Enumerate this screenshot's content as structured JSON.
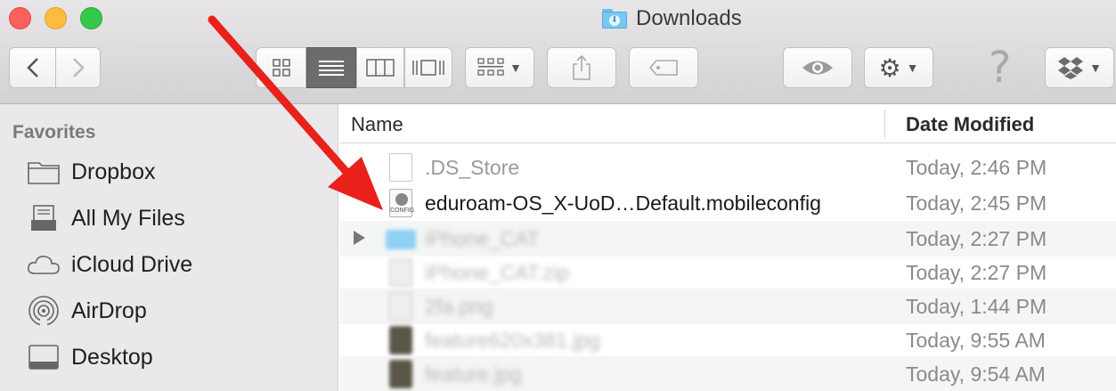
{
  "window": {
    "title": "Downloads"
  },
  "sidebar": {
    "heading": "Favorites",
    "items": [
      {
        "label": "Dropbox",
        "icon": "folder-icon"
      },
      {
        "label": "All My Files",
        "icon": "all-files-icon"
      },
      {
        "label": "iCloud Drive",
        "icon": "cloud-icon"
      },
      {
        "label": "AirDrop",
        "icon": "airdrop-icon"
      },
      {
        "label": "Desktop",
        "icon": "desktop-icon"
      }
    ]
  },
  "list": {
    "columns": {
      "name": "Name",
      "date": "Date Modified"
    },
    "rows": [
      {
        "name": ".DS_Store",
        "date": "Today, 2:46 PM"
      },
      {
        "name": "eduroam-OS_X-UoD…Default.mobileconfig",
        "date": "Today, 2:45 PM",
        "icon_label": "CONFIG"
      },
      {
        "name": "iPhone_CAT",
        "date": "Today, 2:27 PM"
      },
      {
        "name": "iPhone_CAT.zip",
        "date": "Today, 2:27 PM"
      },
      {
        "name": "2fa.png",
        "date": "Today, 1:44 PM"
      },
      {
        "name": "feature620x381.jpg",
        "date": "Today, 9:55 AM"
      },
      {
        "name": "feature.jpg",
        "date": "Today, 9:54 AM"
      }
    ]
  },
  "colors": {
    "annotation_arrow": "#e8211b",
    "folder_accent": "#79c8f2"
  }
}
